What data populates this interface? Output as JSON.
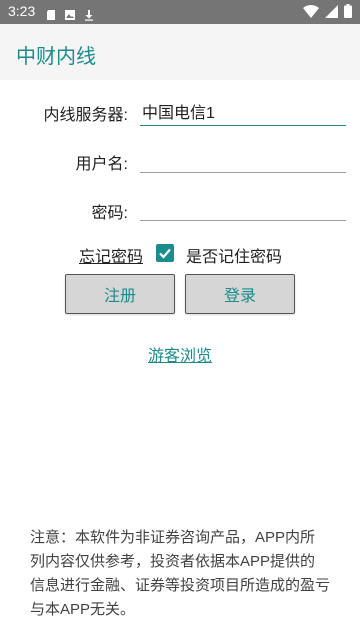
{
  "status_bar": {
    "time": "3:23",
    "left_icons": [
      "sd-card-icon",
      "image-icon",
      "download-icon"
    ],
    "right_icons": [
      "wifi-icon",
      "signal-icon",
      "battery-icon"
    ]
  },
  "app_bar": {
    "title": "中财内线"
  },
  "form": {
    "server": {
      "label": "内线服务器:",
      "value": "中国电信1"
    },
    "username": {
      "label": "用户名:",
      "value": "",
      "placeholder": ""
    },
    "password": {
      "label": "密码:",
      "value": "",
      "placeholder": ""
    }
  },
  "options": {
    "forgot_password": "忘记密码",
    "remember_checked": true,
    "remember_label": "是否记住密码"
  },
  "buttons": {
    "register": "注册",
    "login": "登录"
  },
  "guest_link": "游客浏览",
  "disclaimer": "注意：本软件为非证券咨询产品，APP内所列内容仅供参考，投资者依据本APP提供的信息进行金融、证券等投资项目所造成的盈亏与本APP无关。",
  "colors": {
    "accent": "#1a8c8c",
    "status_bar": "#757575",
    "app_bar": "#f5f5f5",
    "button_bg": "#d6d6d6"
  }
}
